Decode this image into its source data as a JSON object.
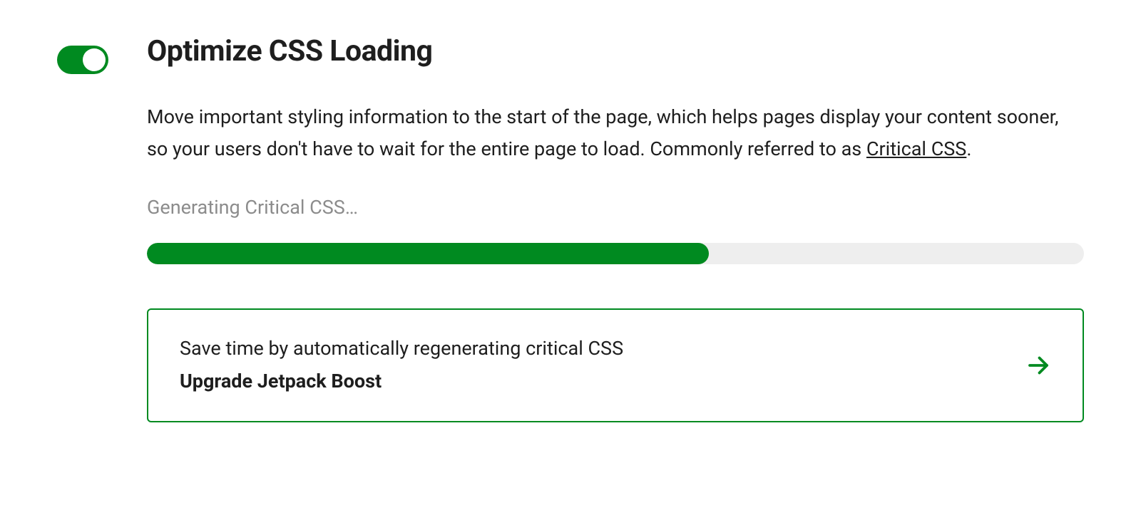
{
  "setting": {
    "enabled": true,
    "title": "Optimize CSS Loading",
    "description_prefix": "Move important styling information to the start of the page, which helps pages display your content sooner, so your users don't have to wait for the entire page to load. Commonly referred to as ",
    "description_link": "Critical CSS",
    "description_suffix": ".",
    "status_text": "Generating Critical CSS…",
    "progress_percent": 60,
    "upgrade": {
      "line1": "Save time by automatically regenerating critical CSS",
      "line2": "Upgrade Jetpack Boost"
    },
    "colors": {
      "accent": "#008a20",
      "muted": "#8c8c8c",
      "progress_bg": "#eeeeee"
    }
  }
}
